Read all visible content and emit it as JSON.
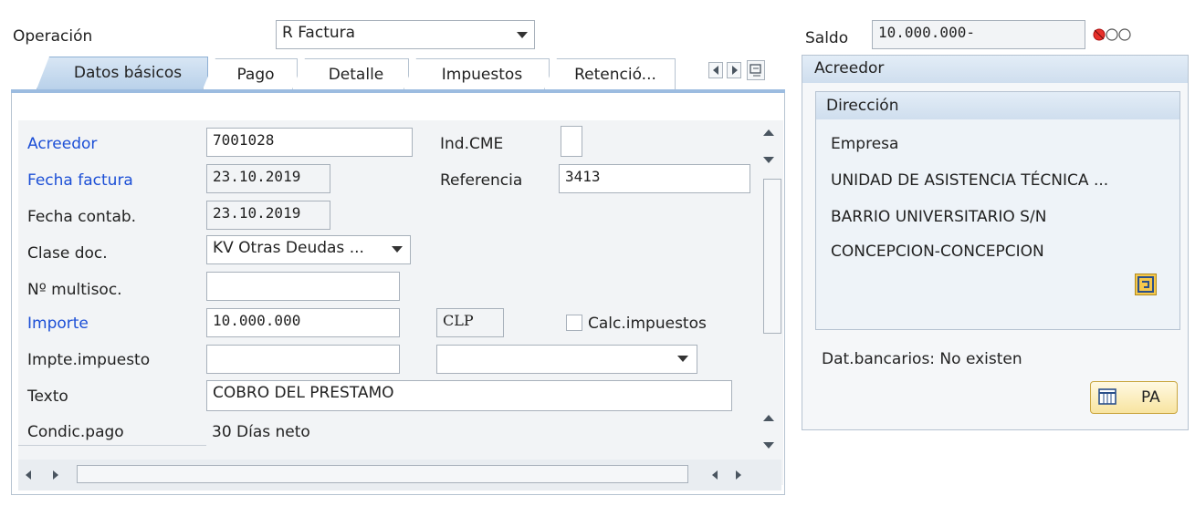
{
  "header": {
    "operacion_label": "Operación",
    "operacion_value": "R Factura",
    "saldo_label": "Saldo",
    "saldo_value": "10.000.000-"
  },
  "tabs": [
    {
      "label": "Datos básicos",
      "active": true
    },
    {
      "label": "Pago"
    },
    {
      "label": "Detalle"
    },
    {
      "label": "Impuestos"
    },
    {
      "label": "Retenció..."
    }
  ],
  "form": {
    "acreedor_label": "Acreedor",
    "acreedor_value": "7001028",
    "indcme_label": "Ind.CME",
    "fecha_factura_label": "Fecha factura",
    "fecha_factura_value": "23.10.2019",
    "referencia_label": "Referencia",
    "referencia_value": "3413",
    "fecha_contab_label": "Fecha contab.",
    "fecha_contab_value": "23.10.2019",
    "clase_doc_label": "Clase doc.",
    "clase_doc_value": "KV Otras Deudas ...",
    "multisoc_label": "Nº multisoc.",
    "multisoc_value": "",
    "importe_label": "Importe",
    "importe_value": "10.000.000",
    "currency_value": "CLP",
    "calc_label": "Calc.impuestos",
    "impte_label": "Impte.impuesto",
    "impte_value": "",
    "texto_label": "Texto",
    "texto_value": "COBRO DEL PRESTAMO",
    "condic_label": "Condic.pago",
    "condic_value": "30 Días neto"
  },
  "right": {
    "title": "Acreedor",
    "direccion_title": "Dirección",
    "address": [
      "Empresa",
      "UNIDAD DE ASISTENCIA TÉCNICA ...",
      "BARRIO UNIVERSITARIO S/N",
      "CONCEPCION-CONCEPCION"
    ],
    "bank_text": "Dat.bancarios: No existen",
    "pa_label": "PA"
  },
  "colors": {
    "accent_blue": "#1c4fd6",
    "status_red": "#e8302a"
  }
}
